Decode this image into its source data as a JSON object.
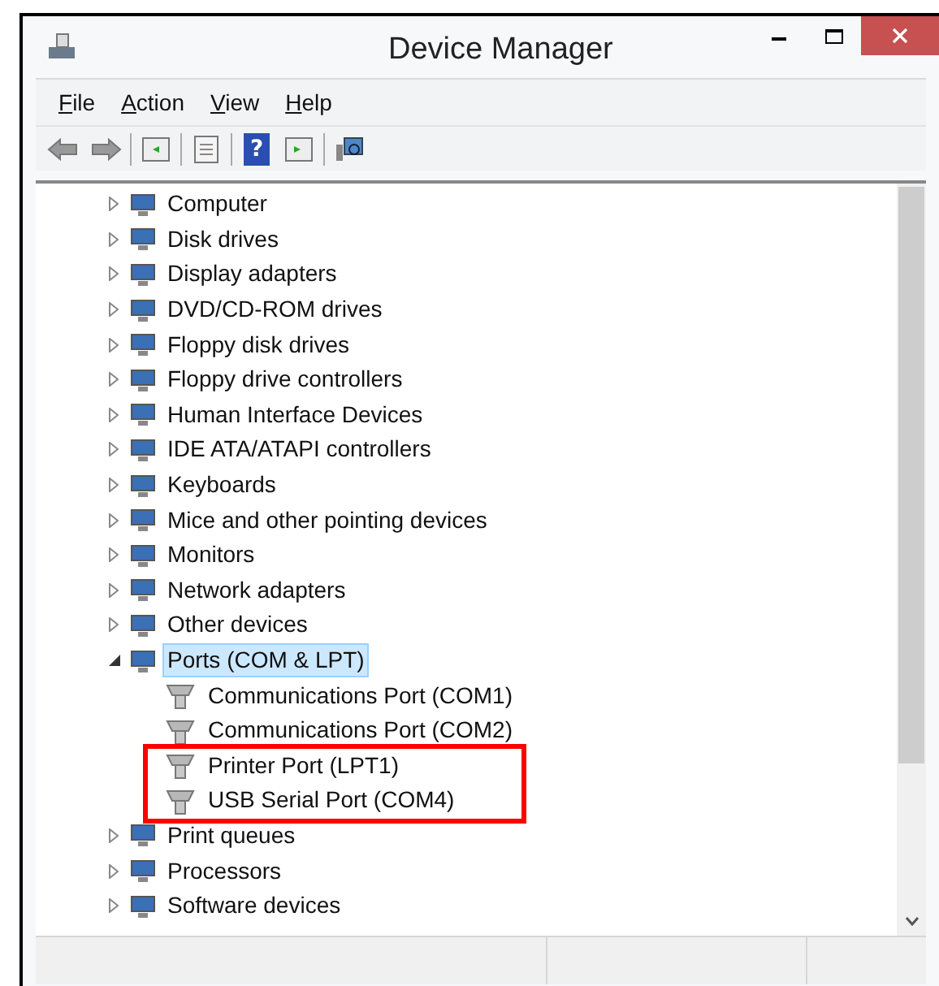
{
  "window": {
    "title": "Device Manager"
  },
  "menu": [
    {
      "label": "File"
    },
    {
      "label": "Action"
    },
    {
      "label": "View"
    },
    {
      "label": "Help"
    }
  ],
  "toolbar": {
    "help_glyph": "?"
  },
  "tree": [
    {
      "label": "Computer",
      "expanded": false,
      "selected": false
    },
    {
      "label": "Disk drives",
      "expanded": false,
      "selected": false
    },
    {
      "label": "Display adapters",
      "expanded": false,
      "selected": false
    },
    {
      "label": "DVD/CD-ROM drives",
      "expanded": false,
      "selected": false
    },
    {
      "label": "Floppy disk drives",
      "expanded": false,
      "selected": false
    },
    {
      "label": "Floppy drive controllers",
      "expanded": false,
      "selected": false
    },
    {
      "label": "Human Interface Devices",
      "expanded": false,
      "selected": false
    },
    {
      "label": "IDE ATA/ATAPI controllers",
      "expanded": false,
      "selected": false
    },
    {
      "label": "Keyboards",
      "expanded": false,
      "selected": false
    },
    {
      "label": "Mice and other pointing devices",
      "expanded": false,
      "selected": false
    },
    {
      "label": "Monitors",
      "expanded": false,
      "selected": false
    },
    {
      "label": "Network adapters",
      "expanded": false,
      "selected": false
    },
    {
      "label": "Other devices",
      "expanded": false,
      "selected": false
    },
    {
      "label": "Ports (COM & LPT)",
      "expanded": true,
      "selected": true,
      "children": [
        {
          "label": "Communications Port (COM1)",
          "selected": false
        },
        {
          "label": "Communications Port (COM2)",
          "selected": false
        },
        {
          "label": "Printer Port (LPT1)",
          "selected": false
        },
        {
          "label": "USB Serial Port (COM4)",
          "selected": false
        }
      ]
    },
    {
      "label": "Print queues",
      "expanded": false,
      "selected": false
    },
    {
      "label": "Processors",
      "expanded": false,
      "selected": false
    },
    {
      "label": "Software devices",
      "expanded": false,
      "selected": false
    }
  ]
}
